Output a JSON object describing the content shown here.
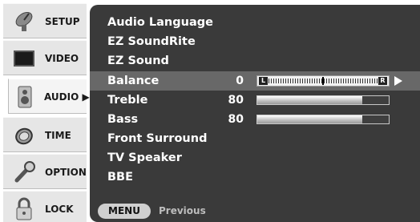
{
  "tabs": [
    {
      "label": "SETUP",
      "icon": "satellite-dish-icon"
    },
    {
      "label": "VIDEO",
      "icon": "monitor-icon"
    },
    {
      "label": "AUDIO ▶",
      "icon": "speaker-icon"
    },
    {
      "label": "TIME",
      "icon": "clock-icon"
    },
    {
      "label": "OPTION",
      "icon": "wrench-icon"
    },
    {
      "label": "LOCK",
      "icon": "padlock-icon"
    }
  ],
  "active_tab": "AUDIO",
  "menu": {
    "items": [
      {
        "label": "Audio Language"
      },
      {
        "label": "EZ SoundRite"
      },
      {
        "label": "EZ Sound"
      },
      {
        "label": "Balance",
        "value": "0",
        "left_tag": "L",
        "right_tag": "R",
        "balance_level": 0
      },
      {
        "label": "Treble",
        "value": "80",
        "level_percent": 80
      },
      {
        "label": "Bass",
        "value": "80",
        "level_percent": 80
      },
      {
        "label": "Front Surround"
      },
      {
        "label": "TV Speaker"
      },
      {
        "label": "BBE"
      }
    ],
    "selected": "Balance"
  },
  "footer": {
    "menu_label": "MENU",
    "hint": "Previous"
  },
  "colors": {
    "panel": "#3a3a3a",
    "selected_row": "#686868",
    "tab_bg": "#e6e6e6",
    "text": "#ffffff"
  }
}
